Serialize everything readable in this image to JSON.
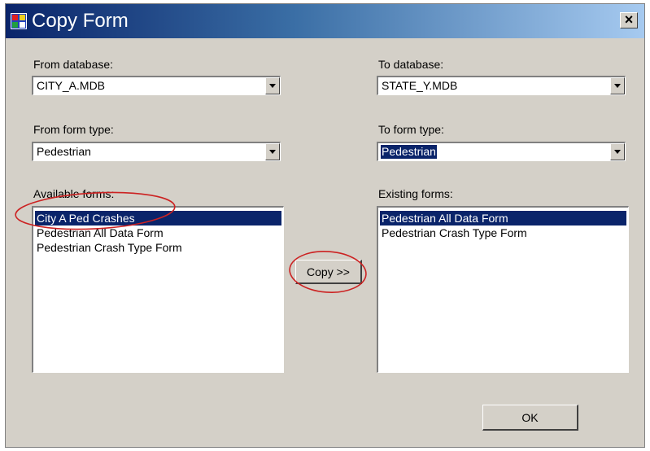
{
  "window": {
    "title": "Copy Form",
    "close_glyph": "×"
  },
  "from": {
    "database_label": "From database:",
    "database_value": "CITY_A.MDB",
    "form_type_label": "From form type:",
    "form_type_value": "Pedestrian",
    "forms_label": "Available forms:",
    "forms": [
      {
        "label": "City A Ped Crashes",
        "selected": true
      },
      {
        "label": "Pedestrian All Data Form",
        "selected": false
      },
      {
        "label": "Pedestrian Crash Type Form",
        "selected": false
      }
    ]
  },
  "to": {
    "database_label": "To database:",
    "database_value": "STATE_Y.MDB",
    "form_type_label": "To form type:",
    "form_type_value": "Pedestrian",
    "forms_label": "Existing forms:",
    "forms": [
      {
        "label": "Pedestrian All Data Form",
        "selected": true
      },
      {
        "label": "Pedestrian Crash Type Form",
        "selected": false
      }
    ]
  },
  "buttons": {
    "copy_label": "Copy >>",
    "ok_label": "OK"
  },
  "colors": {
    "selection": "#0a246a",
    "annotation": "#cc2222",
    "dialog_face": "#d4d0c8"
  },
  "icons": {
    "app": "form-grid-icon",
    "close": "close-icon",
    "dropdown": "chevron-down-icon"
  }
}
